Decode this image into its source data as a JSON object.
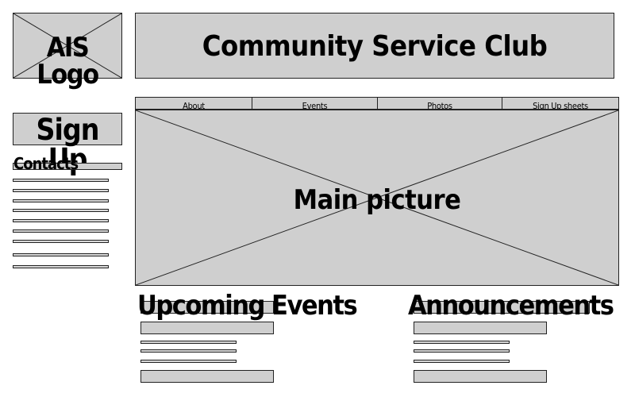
{
  "logo": {
    "label": "AIS Logo"
  },
  "header": {
    "title": "Community Service Club"
  },
  "signup": {
    "label": "Sign Up"
  },
  "contacts": {
    "label": "Contacts"
  },
  "nav": {
    "tabs": [
      "About",
      "Events",
      "Photos",
      "Sign Up sheets"
    ]
  },
  "main": {
    "picture_label": "Main picture"
  },
  "events": {
    "title": "Upcoming Events"
  },
  "announcements": {
    "title": "Announcements"
  },
  "colors": {
    "placeholder_fill": "#cfcfcf",
    "stroke": "#222222",
    "background": "#ffffff"
  }
}
